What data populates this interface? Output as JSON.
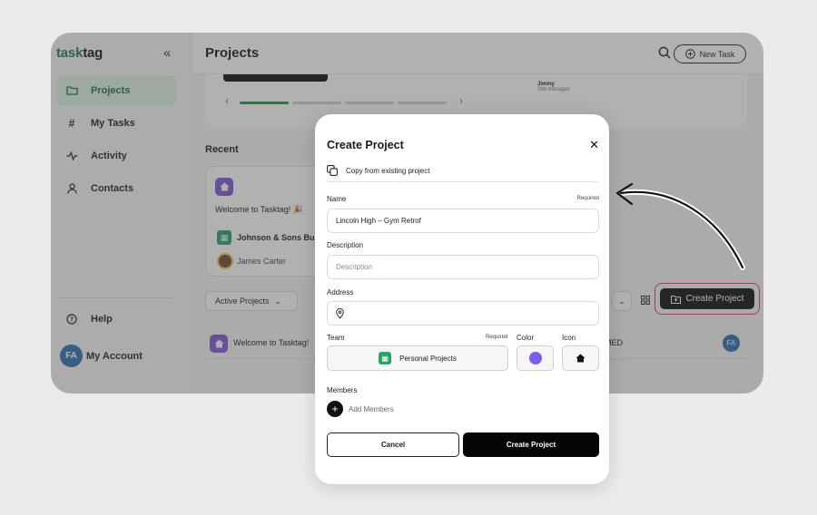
{
  "app": {
    "logo_left": "task",
    "logo_right": "tag",
    "collapse_icon": "«"
  },
  "sidebar": {
    "items": [
      {
        "label": "Projects",
        "icon": "folder-icon"
      },
      {
        "label": "My Tasks",
        "icon": "hash-icon"
      },
      {
        "label": "Activity",
        "icon": "activity-icon"
      },
      {
        "label": "Contacts",
        "icon": "person-icon"
      }
    ],
    "help_label": "Help",
    "account_label": "My Account",
    "account_initials": "FA"
  },
  "header": {
    "title": "Projects",
    "new_task_label": "New Task"
  },
  "carousel": {
    "person_name": "Jimmy",
    "person_role": "Site Manager"
  },
  "recent": {
    "title": "Recent",
    "card": {
      "title": "Welcome to Tasktag! 🎉",
      "org": "Johnson & Sons Bui",
      "user": "James Carter"
    }
  },
  "filters": {
    "active_label": "Active Projects",
    "create_label": "Create Project"
  },
  "list": {
    "rows": [
      {
        "title": "Welcome to Tasktag!",
        "status": "MED",
        "initials": "FA"
      }
    ]
  },
  "modal": {
    "title": "Create Project",
    "copy_label": "Copy from existing project",
    "name_label": "Name",
    "name_required": "Required",
    "name_value": "Lincoln High – Gym Retrof",
    "description_label": "Description",
    "description_placeholder": "Description",
    "address_label": "Address",
    "team_label": "Team",
    "team_required": "Required",
    "team_value": "Personal Projects",
    "color_label": "Color",
    "color_value": "#7d5cf0",
    "icon_label": "Icon",
    "members_label": "Members",
    "add_members_label": "Add Members",
    "cancel_label": "Cancel",
    "create_label": "Create Project"
  }
}
